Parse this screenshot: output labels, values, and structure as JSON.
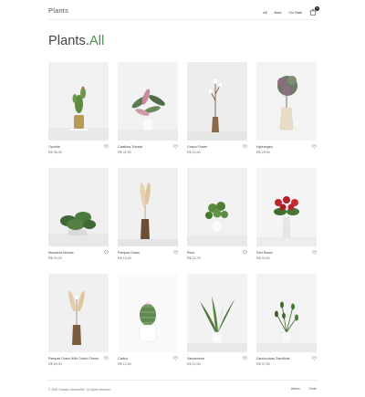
{
  "site": {
    "logo": "Plants",
    "nav": [
      {
        "label": "All"
      },
      {
        "label": "New"
      },
      {
        "label": "On Sale"
      }
    ],
    "cart_count": "0"
  },
  "page": {
    "title_main": "Plants.",
    "title_accent": "All",
    "accent_color": "#4a8f4a"
  },
  "products": [
    {
      "name": "Opuntia",
      "price": "R$ 35,00",
      "icon": "cactus-plant"
    },
    {
      "name": "Calathea Triostar",
      "price": "R$ 32,90",
      "icon": "calathea-plant"
    },
    {
      "name": "Cotton Flower",
      "price": "R$ 10,00",
      "icon": "cotton-stem"
    },
    {
      "name": "Hydrangea",
      "price": "R$ 29,00",
      "icon": "hydrangea-flower"
    },
    {
      "name": "Monstera Minima",
      "price": "R$ 20,00",
      "icon": "monstera-plant"
    },
    {
      "name": "Pampas Grass",
      "price": "R$ 15,40",
      "icon": "pampas-grass"
    },
    {
      "name": "Pilea",
      "price": "R$ 13,75",
      "icon": "pilea-plant"
    },
    {
      "name": "Red Roses",
      "price": "R$ 44,00",
      "icon": "red-roses"
    },
    {
      "name": "Pampas Grass With Cotton Flower",
      "price": "R$ 20,00",
      "icon": "pampas-cotton"
    },
    {
      "name": "Cactus",
      "price": "R$ 12,50",
      "icon": "cactus-pot"
    },
    {
      "name": "Sansevieria",
      "price": "R$ 12,00",
      "icon": "sansevieria-plant"
    },
    {
      "name": "Zamioculcas Zamiifolia",
      "price": "R$ 37,90",
      "icon": "zz-plant"
    }
  ],
  "footer": {
    "copyright": "© 2020 Gustavo Mompellim · All rights reserved",
    "links": [
      {
        "label": "Admin"
      },
      {
        "label": "Code"
      }
    ]
  }
}
